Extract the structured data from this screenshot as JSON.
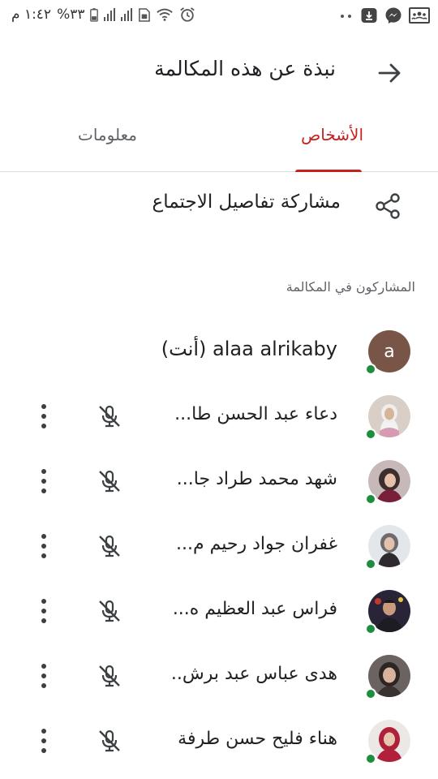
{
  "status_bar": {
    "time": "١:٤٢ م",
    "battery": "%٣٣",
    "icons": [
      "battery-icon",
      "signal-icon",
      "signal-icon",
      "sim-icon",
      "wifi-icon",
      "alarm-icon",
      "more-notifications-icon",
      "download-icon",
      "messenger-icon",
      "classroom-icon"
    ]
  },
  "header": {
    "title": "نبذة عن هذه المكالمة",
    "back_icon": "arrow-icon"
  },
  "tabs": [
    {
      "label": "الأشخاص",
      "selected": true
    },
    {
      "label": "معلومات",
      "selected": false
    }
  ],
  "colors": {
    "accent": "#c5221f",
    "presence": "#1e8e3e",
    "avatar_letter_bg": "#795548"
  },
  "share": {
    "label": "مشاركة تفاصيل الاجتماع",
    "icon": "share-icon"
  },
  "section_label": "المشاركون في المكالمة",
  "participants": [
    {
      "name": "alaa alrikaby (أنت)",
      "avatar_letter": "a",
      "self": true
    },
    {
      "name": "دعاء عبد الحسن طا...",
      "muted": true
    },
    {
      "name": "شهد محمد طراد جا...",
      "muted": true
    },
    {
      "name": "غفران جواد رحيم م...",
      "muted": true
    },
    {
      "name": "فراس عبد العظيم ه...",
      "muted": true
    },
    {
      "name": "هدى عباس عبد برش..",
      "muted": true
    },
    {
      "name": "هناء فليح حسن طرفة",
      "muted": true
    }
  ]
}
